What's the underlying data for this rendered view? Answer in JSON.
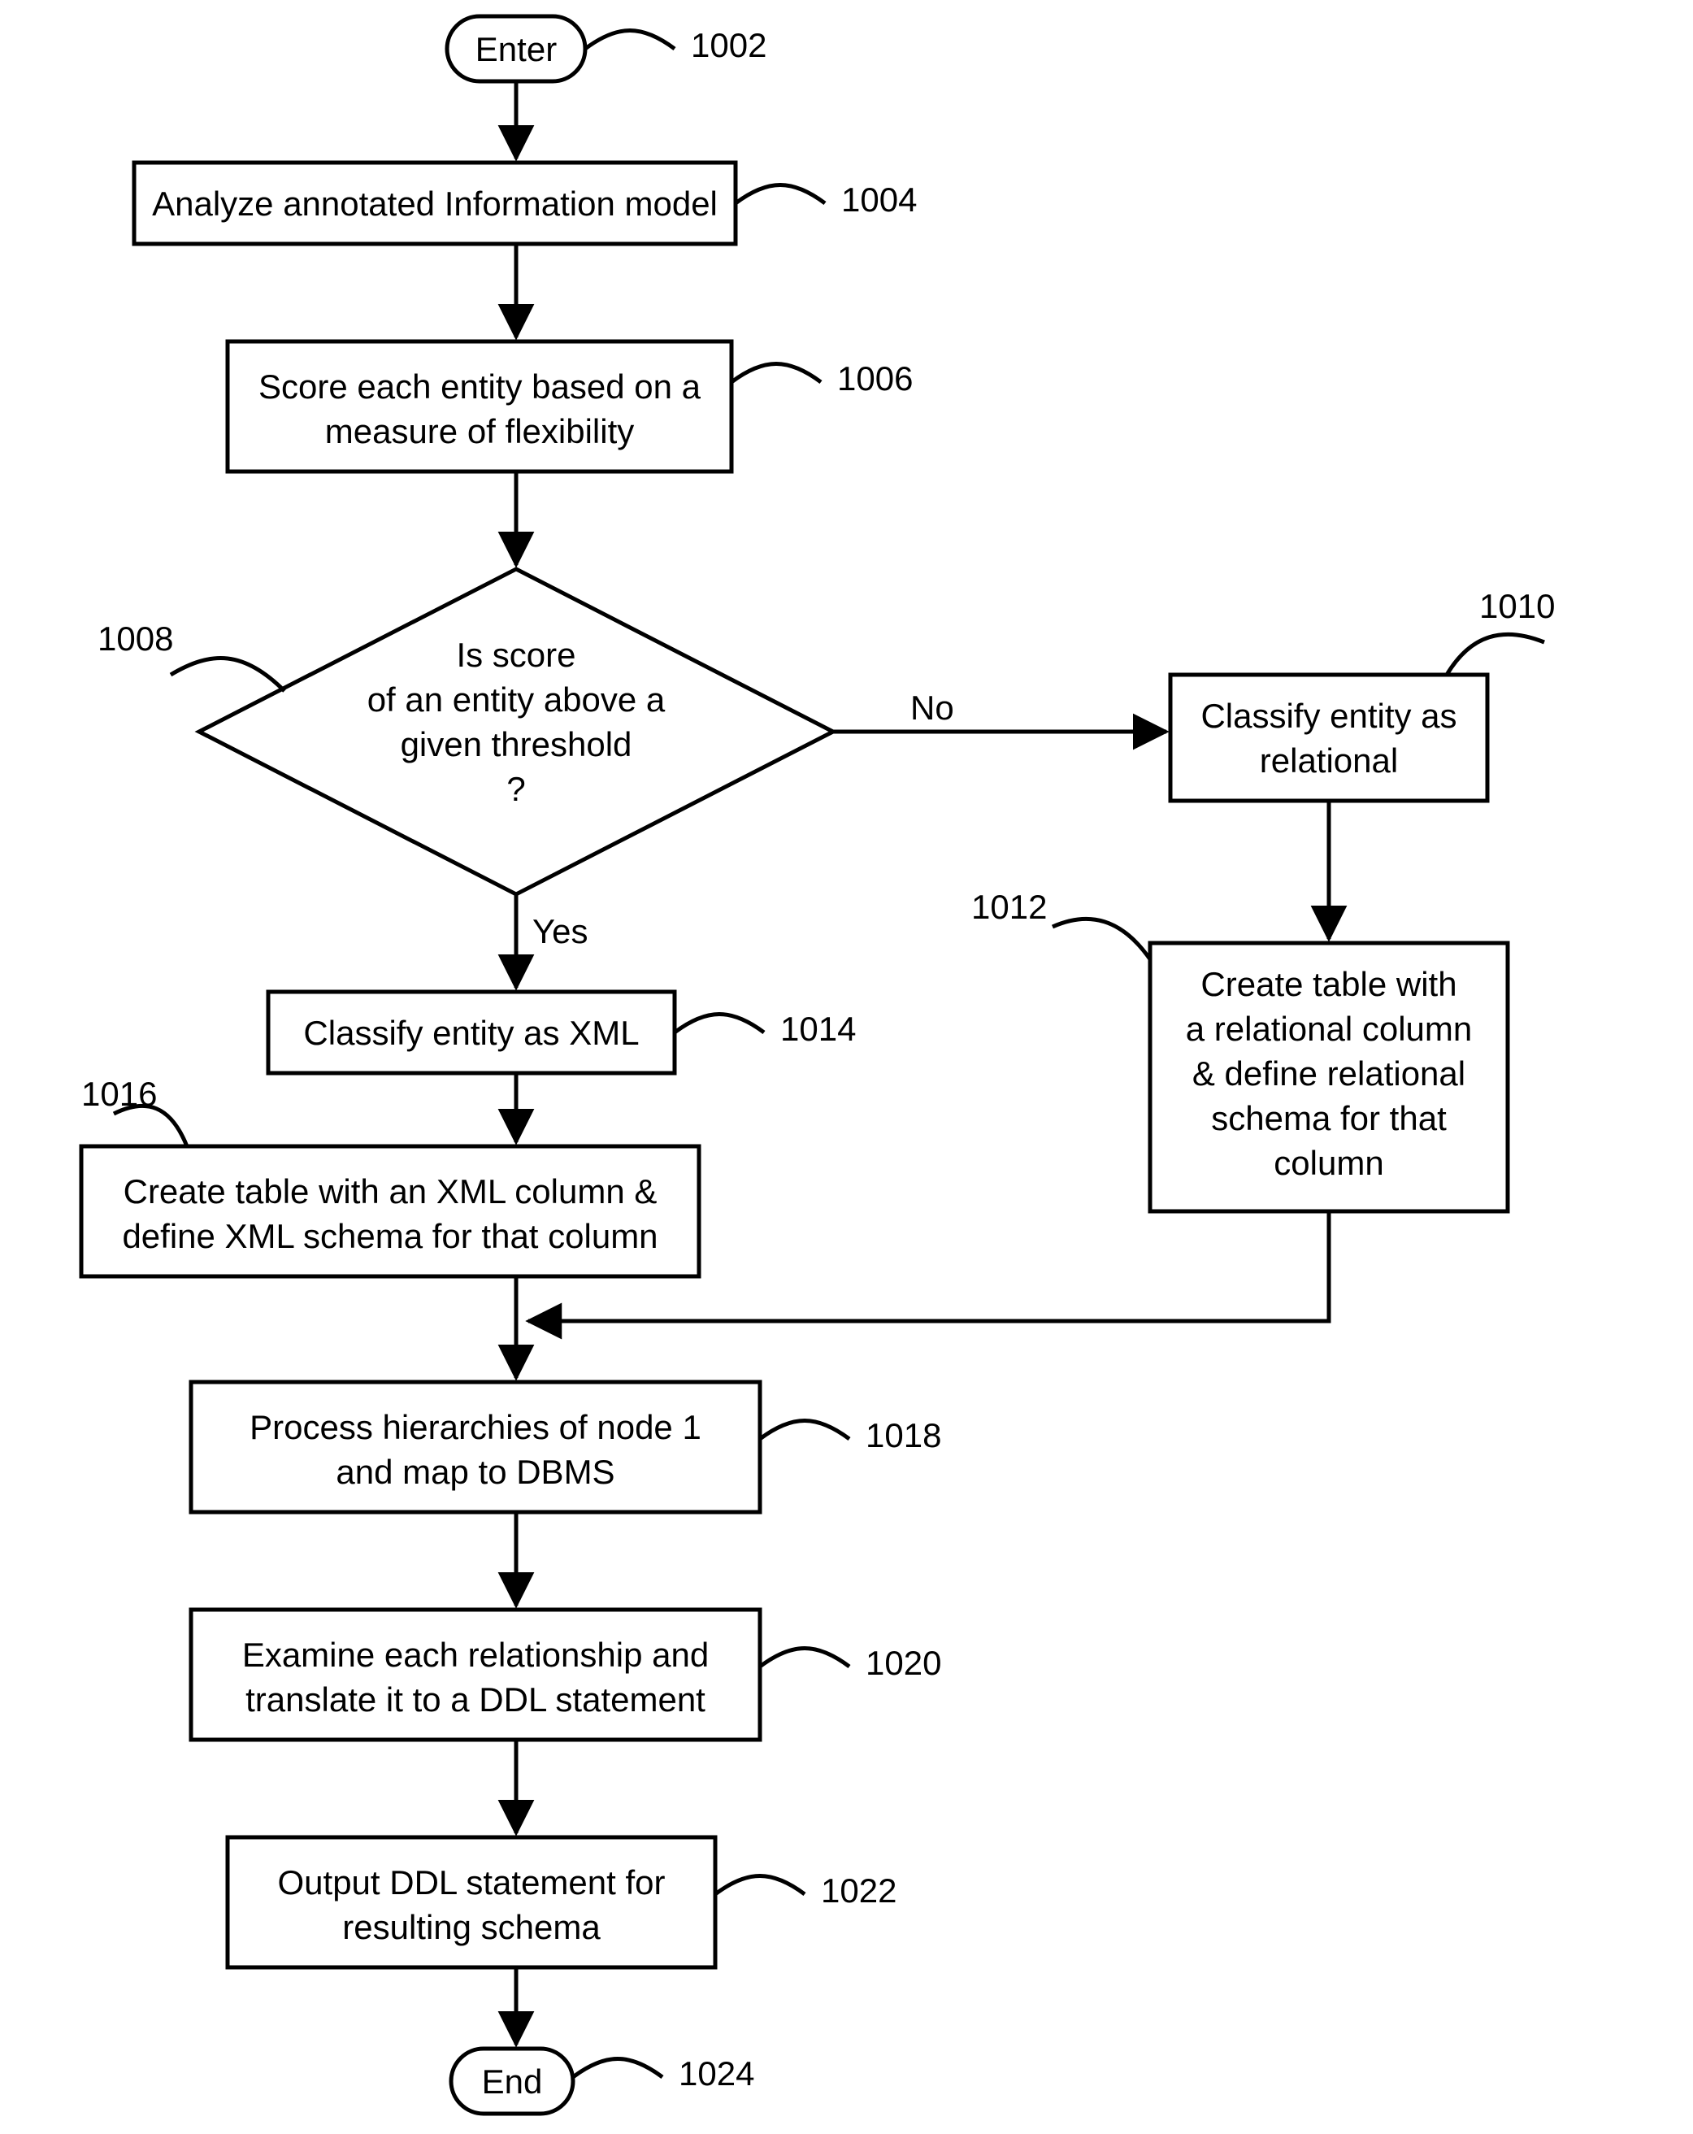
{
  "flowchart": {
    "terminators": {
      "enter": {
        "text": "Enter",
        "ref": "1002"
      },
      "end": {
        "text": "End",
        "ref": "1024"
      }
    },
    "processes": {
      "analyze": {
        "lines": [
          "Analyze annotated Information model"
        ],
        "ref": "1004"
      },
      "score": {
        "lines": [
          "Score each entity based on a",
          "measure of flexibility"
        ],
        "ref": "1006"
      },
      "classify_xml": {
        "lines": [
          "Classify entity as XML"
        ],
        "ref": "1014"
      },
      "create_xml": {
        "lines": [
          "Create table with an XML column &",
          "define XML schema for that column"
        ],
        "ref": "1016"
      },
      "classify_rel": {
        "lines": [
          "Classify entity as",
          "relational"
        ],
        "ref": "1010"
      },
      "create_rel": {
        "lines": [
          "Create table with",
          "a relational column",
          "& define relational",
          "schema for that",
          "column"
        ],
        "ref": "1012"
      },
      "process_hier": {
        "lines": [
          "Process hierarchies of node 1",
          "and map to DBMS"
        ],
        "ref": "1018"
      },
      "examine": {
        "lines": [
          "Examine each relationship and",
          "translate it to a DDL statement"
        ],
        "ref": "1020"
      },
      "output": {
        "lines": [
          "Output DDL statement for",
          "resulting schema"
        ],
        "ref": "1022"
      }
    },
    "decision": {
      "threshold": {
        "lines": [
          "Is score",
          "of an entity above a",
          "given threshold",
          "?"
        ],
        "ref": "1008",
        "yes_label": "Yes",
        "no_label": "No"
      }
    }
  }
}
